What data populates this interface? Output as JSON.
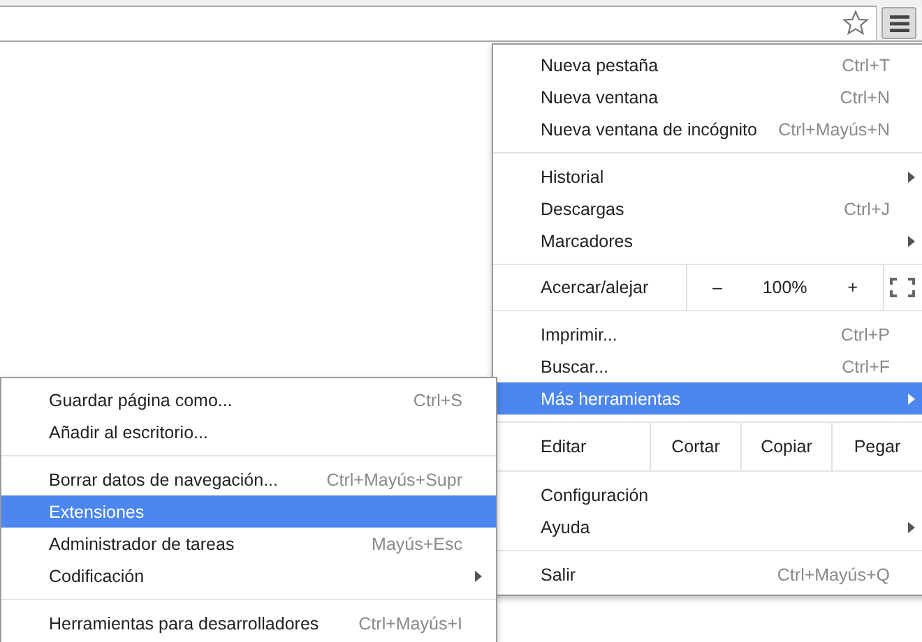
{
  "main_menu": {
    "items": [
      {
        "kind": "item",
        "label": "Nueva pestaña",
        "shortcut": "Ctrl+T",
        "submenu": false,
        "selected": false
      },
      {
        "kind": "item",
        "label": "Nueva ventana",
        "shortcut": "Ctrl+N",
        "submenu": false,
        "selected": false
      },
      {
        "kind": "item",
        "label": "Nueva ventana de incógnito",
        "shortcut": "Ctrl+Mayús+N",
        "submenu": false,
        "selected": false
      },
      {
        "kind": "separator"
      },
      {
        "kind": "item",
        "label": "Historial",
        "submenu": true,
        "selected": false
      },
      {
        "kind": "item",
        "label": "Descargas",
        "shortcut": "Ctrl+J",
        "submenu": false,
        "selected": false
      },
      {
        "kind": "item",
        "label": "Marcadores",
        "submenu": true,
        "selected": false
      },
      {
        "kind": "separator"
      },
      {
        "kind": "zoom",
        "label": "Acercar/alejar",
        "minus": "–",
        "value": "100%",
        "plus": "+"
      },
      {
        "kind": "separator"
      },
      {
        "kind": "item",
        "label": "Imprimir...",
        "shortcut": "Ctrl+P",
        "submenu": false,
        "selected": false
      },
      {
        "kind": "item",
        "label": "Buscar...",
        "shortcut": "Ctrl+F",
        "submenu": false,
        "selected": false
      },
      {
        "kind": "item",
        "label": "Más herramientas",
        "submenu": true,
        "selected": true
      },
      {
        "kind": "separator"
      },
      {
        "kind": "edit",
        "label": "Editar",
        "actions": [
          "Cortar",
          "Copiar",
          "Pegar"
        ]
      },
      {
        "kind": "separator"
      },
      {
        "kind": "item",
        "label": "Configuración",
        "submenu": false,
        "selected": false
      },
      {
        "kind": "item",
        "label": "Ayuda",
        "submenu": true,
        "selected": false
      },
      {
        "kind": "separator"
      },
      {
        "kind": "item",
        "label": "Salir",
        "shortcut": "Ctrl+Mayús+Q",
        "submenu": false,
        "selected": false
      }
    ]
  },
  "submenu": {
    "items": [
      {
        "kind": "item",
        "label": "Guardar página como...",
        "shortcut": "Ctrl+S",
        "submenu": false,
        "selected": false
      },
      {
        "kind": "item",
        "label": "Añadir al escritorio...",
        "submenu": false,
        "selected": false
      },
      {
        "kind": "separator"
      },
      {
        "kind": "item",
        "label": "Borrar datos de navegación...",
        "shortcut": "Ctrl+Mayús+Supr",
        "submenu": false,
        "selected": false
      },
      {
        "kind": "item",
        "label": "Extensiones",
        "submenu": false,
        "selected": true
      },
      {
        "kind": "item",
        "label": "Administrador de tareas",
        "shortcut": "Mayús+Esc",
        "submenu": false,
        "selected": false
      },
      {
        "kind": "item",
        "label": "Codificación",
        "submenu": true,
        "selected": false
      },
      {
        "kind": "separator"
      },
      {
        "kind": "item",
        "label": "Herramientas para desarrolladores",
        "shortcut": "Ctrl+Mayús+I",
        "submenu": false,
        "selected": false
      }
    ]
  }
}
